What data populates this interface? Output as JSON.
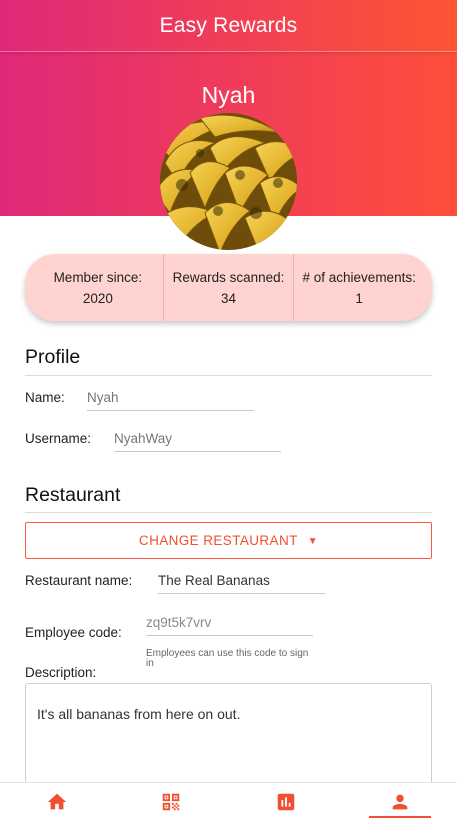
{
  "app": {
    "title": "Easy Rewards"
  },
  "profile_header": {
    "name": "Nyah"
  },
  "stats": [
    {
      "label": "Member since:",
      "value": "2020"
    },
    {
      "label": "Rewards scanned:",
      "value": "34"
    },
    {
      "label": "# of achievements:",
      "value": "1"
    }
  ],
  "profile_section": {
    "title": "Profile",
    "name_label": "Name:",
    "name_placeholder": "Nyah",
    "username_label": "Username:",
    "username_placeholder": "NyahWay"
  },
  "restaurant_section": {
    "title": "Restaurant",
    "change_button": "CHANGE RESTAURANT",
    "restaurant_name_label": "Restaurant name:",
    "restaurant_name_value": "The Real Bananas",
    "employee_code_label": "Employee code:",
    "employee_code_value": "zq9t5k7vrv",
    "employee_code_hint": "Employees can use this code to sign in",
    "description_label": "Description:",
    "description_value": "It's all bananas from here on out."
  },
  "nav": {
    "items": [
      {
        "icon": "home-icon",
        "active": false
      },
      {
        "icon": "qr-code-icon",
        "active": false
      },
      {
        "icon": "bar-chart-icon",
        "active": false
      },
      {
        "icon": "person-icon",
        "active": true
      }
    ]
  },
  "colors": {
    "gradient_start": "#e0287a",
    "gradient_end": "#ff5433",
    "accent": "#f0502f",
    "stats_background": "#ffd3cf"
  }
}
